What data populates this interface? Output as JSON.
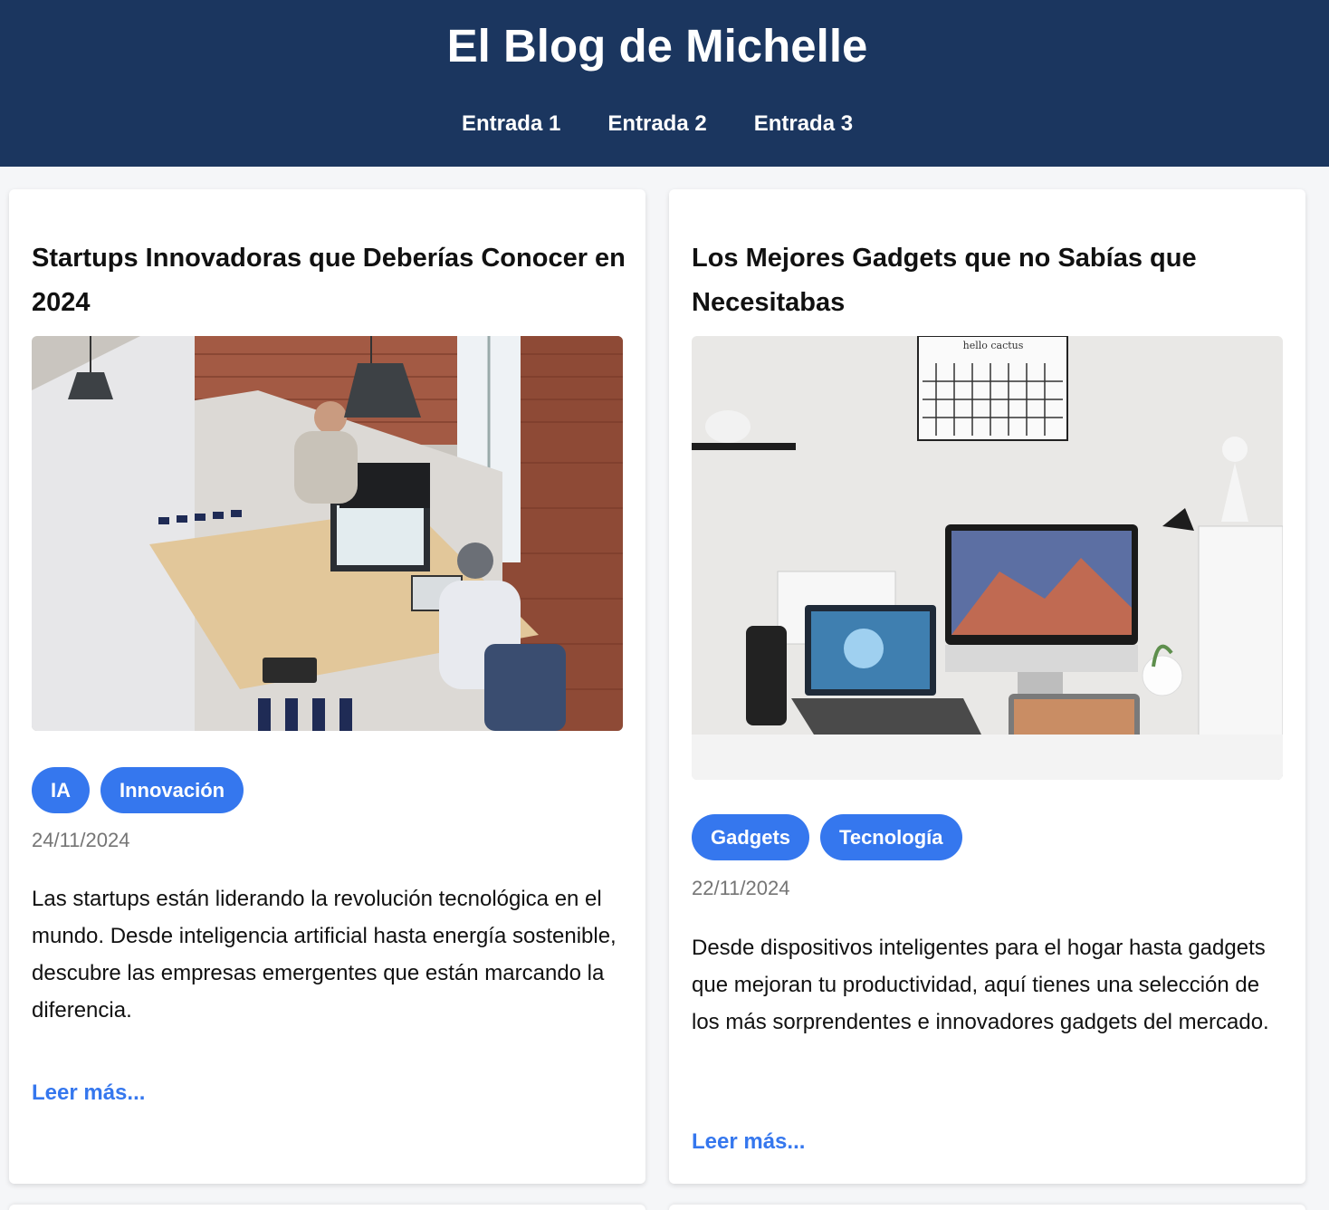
{
  "header": {
    "title": "El Blog de Michelle",
    "nav": [
      "Entrada 1",
      "Entrada 2",
      "Entrada 3"
    ]
  },
  "posts": [
    {
      "title": "Startups Innovadoras que Deberías Conocer en 2024",
      "image_icon": "office-coworking-photo",
      "tags": [
        "IA",
        "Innovación"
      ],
      "date": "24/11/2024",
      "excerpt": "Las startups están liderando la revolución tecnológica en el mundo. Desde inteligencia artificial hasta energía sostenible, descubre las empresas emergentes que están marcando la diferencia.",
      "read_more": "Leer más..."
    },
    {
      "title": "Los Mejores Gadgets que no Sabías que Necesitabas",
      "image_icon": "desk-gadgets-photo",
      "image_sign": "hello cactus",
      "tags": [
        "Gadgets",
        "Tecnología"
      ],
      "date": "22/11/2024",
      "excerpt": "Desde dispositivos inteligentes para el hogar hasta gadgets que mejoran tu productividad, aquí tienes una selección de los más sorprendentes e innovadores gadgets del mercado.",
      "read_more": "Leer más..."
    }
  ],
  "colors": {
    "header_bg": "#1b365f",
    "accent": "#3577ee",
    "date": "#757575"
  }
}
